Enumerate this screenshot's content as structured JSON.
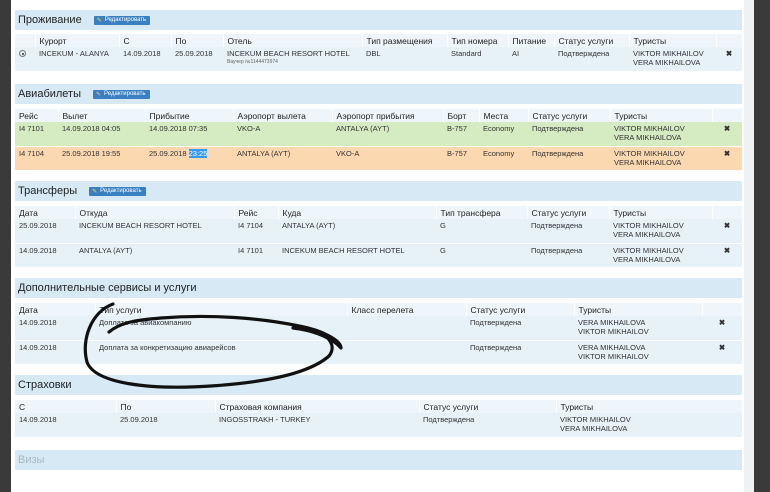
{
  "edit_label": "Редактировать",
  "accommodation": {
    "title": "Проживание",
    "headers": [
      "Курорт",
      "С",
      "По",
      "Отель",
      "Тип размещения",
      "Тип номера",
      "Питание",
      "Статус услуги",
      "Туристы"
    ],
    "rows": [
      {
        "resort": "INCEKUM - ALANYA",
        "from": "14.09.2018",
        "to": "25.09.2018",
        "hotel": "INCEKUM BEACH RESORT HOTEL",
        "voucher": "Ваучер №1144473974",
        "placement": "DBL",
        "room": "Standard",
        "meal": "AI",
        "status": "Подтверждена",
        "tourists": [
          "VIKTOR MIKHAILOV",
          "VERA MIKHAILOVA"
        ]
      }
    ]
  },
  "flights": {
    "title": "Авиабилеты",
    "headers": [
      "Рейс",
      "Вылет",
      "Прибытие",
      "Аэропорт вылета",
      "Аэропорт прибытия",
      "Борт",
      "Места",
      "Статус услуги",
      "Туристы"
    ],
    "rows": [
      {
        "flight": "I4 7101",
        "departure": "14.09.2018 04:05",
        "arrival": "14.09.2018 07:35",
        "arrival_time_selected": "",
        "from": "VKO-A",
        "to": "ANTALYA (AYT)",
        "board": "B-757",
        "seats": "Economy",
        "status": "Подтверждена",
        "tourists": [
          "VIKTOR MIKHAILOV",
          "VERA MIKHAILOVA"
        ]
      },
      {
        "flight": "I4 7104",
        "departure": "25.09.2018 19:55",
        "arrival": "25.09.2018 ",
        "arrival_time_selected": "23:25",
        "from": "ANTALYA (AYT)",
        "to": "VKO-A",
        "board": "B-757",
        "seats": "Economy",
        "status": "Подтверждена",
        "tourists": [
          "VIKTOR MIKHAILOV",
          "VERA MIKHAILOVA"
        ]
      }
    ]
  },
  "transfers": {
    "title": "Трансферы",
    "headers": [
      "Дата",
      "Откуда",
      "Рейс",
      "Куда",
      "Тип трансфера",
      "Статус услуги",
      "Туристы"
    ],
    "rows": [
      {
        "date": "25.09.2018",
        "from": "INCEKUM BEACH RESORT HOTEL",
        "flight": "I4 7104",
        "to": "ANTALYA (AYT)",
        "type": "G",
        "status": "Подтверждена",
        "tourists": [
          "VIKTOR MIKHAILOV",
          "VERA MIKHAILOVA"
        ]
      },
      {
        "date": "14.09.2018",
        "from": "ANTALYA (AYT)",
        "flight": "I4 7101",
        "to": "INCEKUM BEACH RESORT HOTEL",
        "type": "G",
        "status": "Подтверждена",
        "tourists": [
          "VIKTOR MIKHAILOV",
          "VERA MIKHAILOVA"
        ]
      }
    ]
  },
  "extras": {
    "title": "Дополнительные сервисы и услуги",
    "headers": [
      "Дата",
      "Тип услуги",
      "Класс перелета",
      "Статус услуги",
      "Туристы"
    ],
    "rows": [
      {
        "date": "14.09.2018",
        "type": "Доплата за авиакомпанию",
        "class": "",
        "status": "Подтверждена",
        "tourists": [
          "VERA MIKHAILOVA",
          "VIKTOR MIKHAILOV"
        ]
      },
      {
        "date": "14.09.2018",
        "type": "Доплата за конкретизацию авиарейсов",
        "class": "",
        "status": "Подтверждена",
        "tourists": [
          "VERA MIKHAILOVA",
          "VIKTOR MIKHAILOV"
        ]
      }
    ]
  },
  "insurance": {
    "title": "Страховки",
    "headers": [
      "С",
      "По",
      "Страховая компания",
      "Статус услуги",
      "Туристы"
    ],
    "rows": [
      {
        "from": "14.09.2018",
        "to": "25.09.2018",
        "company": "INGOSSTRAKH - TURKEY",
        "status": "Подтверждена",
        "tourists": [
          "VIKTOR MIKHAILOV",
          "VERA MIKHAILOVA"
        ]
      }
    ]
  },
  "visas": {
    "title": "Визы"
  },
  "icons": {
    "delete": "delete-x-icon",
    "edit": "pencil-icon"
  },
  "colors": {
    "section_header": "#d6e9f5",
    "row": "#e6f1f8",
    "flight_out": "#d5ebc2",
    "flight_back": "#fbd8b0",
    "edit_button": "#3a7fc1",
    "delete": "#c62626"
  }
}
